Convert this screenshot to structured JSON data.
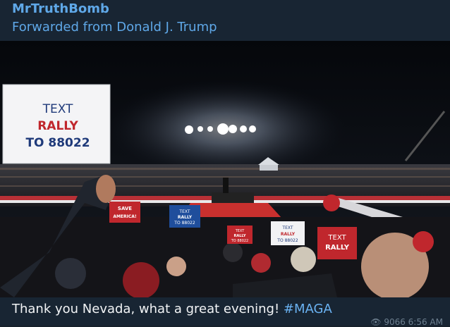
{
  "message": {
    "sender": "MrTruthBomb",
    "forwarded_from": "Forwarded from Donald J. Trump",
    "caption_text": "Thank you Nevada, what a great evening! ",
    "caption_hashtag": "#MAGA",
    "meta": "👁 9066  6:56 AM"
  },
  "photo": {
    "signs": [
      "TEXT",
      "RALLY",
      "TO 88022"
    ],
    "small_sign": [
      "TEXT",
      "RALLY",
      "TO 88022"
    ],
    "save_sign": "SAVE",
    "save_sign_sub": "AMERICA!"
  },
  "colors": {
    "bg": "#182533",
    "link": "#5fa8e8",
    "hashtag": "#6ab2f2",
    "sign_red": "#c0272d",
    "sign_blue": "#1f4e9c"
  }
}
